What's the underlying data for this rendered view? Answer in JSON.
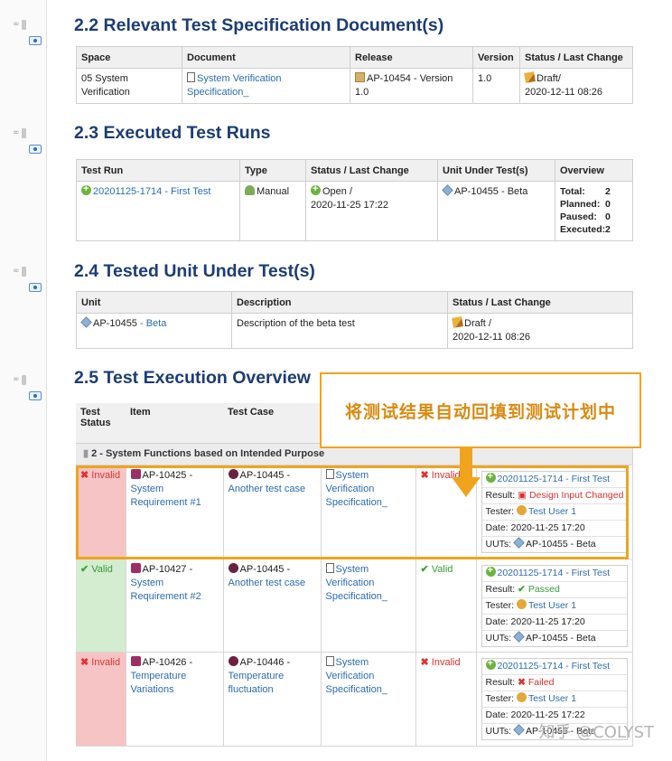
{
  "sections": {
    "s22": {
      "title": "2.2 Relevant Test Specification Document(s)",
      "headers": [
        "Space",
        "Document",
        "Release",
        "Version",
        "Status / Last Change"
      ],
      "row": {
        "space": "05 System Verification",
        "document": "System Verification Specification_",
        "release": "AP-10454 - Version 1.0",
        "version": "1.0",
        "status": "Draft/",
        "date": "2020-12-11 08:26"
      }
    },
    "s23": {
      "title": "2.3 Executed Test Runs",
      "headers": [
        "Test Run",
        "Type",
        "Status / Last Change",
        "Unit Under Test(s)",
        "Overview"
      ],
      "row": {
        "run": "20201125-1714 - First Test",
        "type": "Manual",
        "status": "Open /",
        "date": "2020-11-25 17:22",
        "uut": "AP-10455 - Beta",
        "overview": [
          {
            "label": "Total:",
            "value": "2"
          },
          {
            "label": "Planned:",
            "value": "0"
          },
          {
            "label": "Paused:",
            "value": "0"
          },
          {
            "label": "Executed:",
            "value": "2"
          }
        ]
      }
    },
    "s24": {
      "title": "2.4 Tested Unit Under Test(s)",
      "headers": [
        "Unit",
        "Description",
        "Status / Last Change"
      ],
      "row": {
        "unit_id": "AP-10455",
        "unit_name": "- Beta",
        "description": "Description of the beta test",
        "status": "Draft /",
        "date": "2020-12-11 08:26"
      }
    },
    "s25": {
      "title_num": "2.5",
      "title_text": "Test Execution Overview",
      "headers": [
        "Test Status",
        "Item",
        "Test Case"
      ],
      "group": "2 - System Functions based on Intended Purpose",
      "rows": [
        {
          "status": "Invalid",
          "item_id": "AP-10425 -",
          "item_name": "System Requirement #1",
          "tc_id": "AP-10445 -",
          "tc_name": "Another test case",
          "spec": "System Verification Specification_",
          "result_status": "Invalid",
          "run": "20201125-1714 - First Test",
          "result_label": "Result:",
          "result": "Design Input Changed",
          "tester_label": "Tester:",
          "tester": "Test User 1",
          "date_label": "Date:",
          "date": "2020-11-25 17:20",
          "uuts_label": "UUTs:",
          "uuts": "AP-10455 - Beta"
        },
        {
          "status": "Valid",
          "item_id": "AP-10427 -",
          "item_name": "System Requirement #2",
          "tc_id": "AP-10445 -",
          "tc_name": "Another test case",
          "spec": "System Verification Specification_",
          "result_status": "Valid",
          "run": "20201125-1714 - First Test",
          "result_label": "Result:",
          "result": "Passed",
          "tester_label": "Tester:",
          "tester": "Test User 1",
          "date_label": "Date:",
          "date": "2020-11-25 17:20",
          "uuts_label": "UUTs:",
          "uuts": "AP-10455 - Beta"
        },
        {
          "status": "Invalid",
          "item_id": "AP-10426 -",
          "item_name": "Temperature Variations",
          "tc_id": "AP-10446 -",
          "tc_name": "Temperature fluctuation",
          "spec": "System Verification Specification_",
          "result_status": "Invalid",
          "run": "20201125-1714 - First Test",
          "result_label": "Result:",
          "result": "Failed",
          "tester_label": "Tester:",
          "tester": "Test User 1",
          "date_label": "Date:",
          "date": "2020-11-25 17:22",
          "uuts_label": "UUTs:",
          "uuts": "AP-10455 - Beta"
        }
      ]
    }
  },
  "callout": "将测试结果自动回填到测试计划中",
  "watermark": "知乎 @COLYST",
  "colors": {
    "heading": "#1c3d73",
    "highlight": "#f0a41e",
    "invalid_bg": "#f6c4c4",
    "valid_bg": "#d4ecd0",
    "link": "#2b6cb0"
  }
}
